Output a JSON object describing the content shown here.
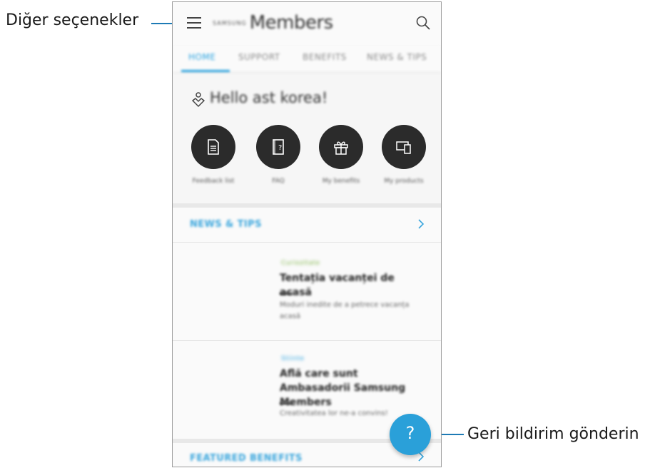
{
  "callouts": {
    "left": "Diğer seçenekler",
    "right": "Geri bildirim gönderin"
  },
  "appbar": {
    "brand_small": "SAMSUNG",
    "brand": "Members"
  },
  "tabs": [
    "HOME",
    "SUPPORT",
    "BENEFITS",
    "NEWS & TIPS"
  ],
  "greeting": "Hello ast korea!",
  "shortcuts": [
    {
      "label": "Feedback list",
      "icon": "document-icon"
    },
    {
      "label": "FAQ",
      "icon": "faq-book-icon"
    },
    {
      "label": "My benefits",
      "icon": "gift-icon"
    },
    {
      "label": "My products",
      "icon": "devices-icon"
    }
  ],
  "news_section": {
    "title": "NEWS & TIPS"
  },
  "articles": [
    {
      "tag": "Curiozitate",
      "tag_color": "#7cb342",
      "title": "Tentația vacanței de acasă",
      "desc": "Moduri inedite de a petrece vacanța acasă"
    },
    {
      "tag": "Stiinte",
      "tag_color": "#2aa3e0",
      "title": "Află care sunt Ambasadorii Samsung Members",
      "desc": "Creativitatea lor ne-a convins!"
    }
  ],
  "featured_section": {
    "title": "FEATURED BENEFITS"
  },
  "fab": {
    "label": "?"
  },
  "colors": {
    "accent": "#2aa3e0",
    "callout_line": "#1d7ab5"
  }
}
